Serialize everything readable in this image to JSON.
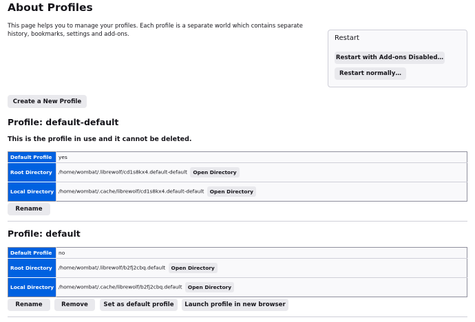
{
  "page": {
    "title": "About Profiles",
    "intro": "This page helps you to manage your profiles. Each profile is a separate world which contains separate history, bookmarks, settings and add-ons."
  },
  "restart": {
    "heading": "Restart",
    "addons_disabled": "Restart with Add-ons Disabled…",
    "normally": "Restart normally…"
  },
  "create_profile_label": "Create a New Profile",
  "labels": {
    "default_profile": "Default Profile",
    "root_directory": "Root Directory",
    "local_directory": "Local Directory",
    "open_directory": "Open Directory"
  },
  "profiles": [
    {
      "title": "Profile: default-default",
      "in_use_note": "This is the profile in use and it cannot be deleted.",
      "default_profile": "yes",
      "root_directory": "/home/wombat/.librewolf/cd1s8kx4.default-default",
      "local_directory": "/home/wombat/.cache/librewolf/cd1s8kx4.default-default",
      "buttons": {
        "rename": "Rename"
      }
    },
    {
      "title": "Profile: default",
      "default_profile": "no",
      "root_directory": "/home/wombat/.librewolf/b2fj2cbq.default",
      "local_directory": "/home/wombat/.cache/librewolf/b2fj2cbq.default",
      "buttons": {
        "rename": "Rename",
        "remove": "Remove",
        "set_default": "Set as default profile",
        "launch": "Launch profile in new browser"
      }
    }
  ]
}
